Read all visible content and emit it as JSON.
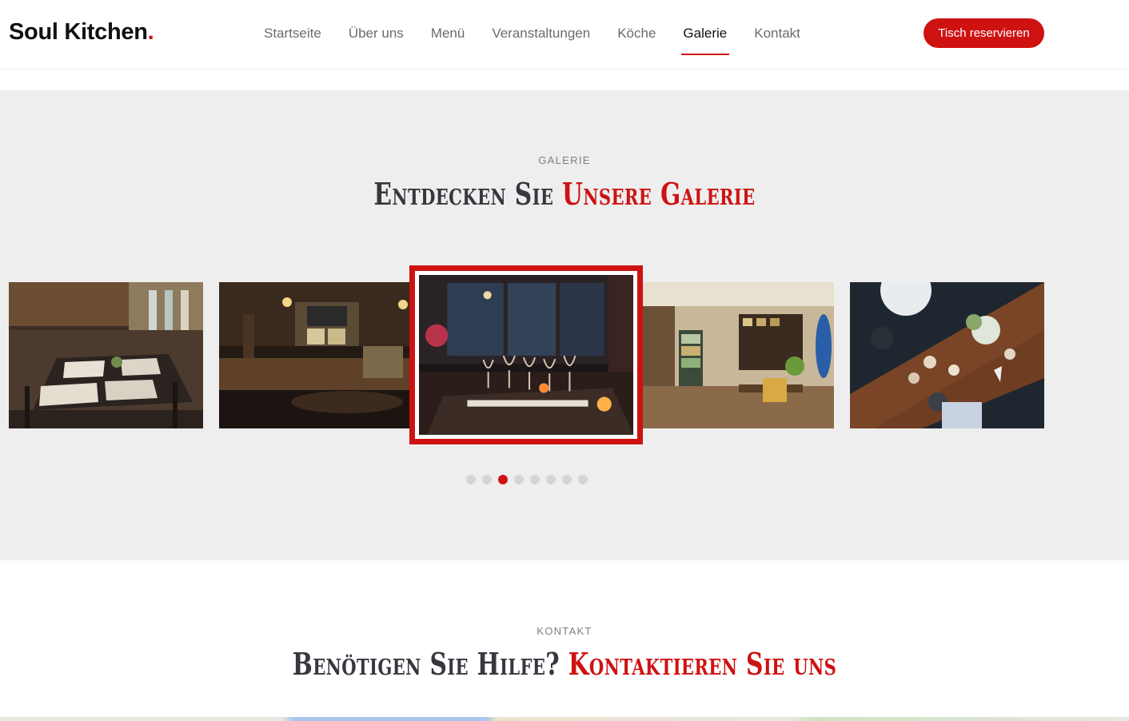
{
  "header": {
    "logo": {
      "text": "Soul Kitchen",
      "dot": "."
    },
    "nav": [
      {
        "label": "Startseite",
        "active": false
      },
      {
        "label": "Über uns",
        "active": false
      },
      {
        "label": "Menü",
        "active": false
      },
      {
        "label": "Veranstaltungen",
        "active": false
      },
      {
        "label": "Köche",
        "active": false
      },
      {
        "label": "Galerie",
        "active": true
      },
      {
        "label": "Kontakt",
        "active": false
      }
    ],
    "cta_label": "Tisch reservieren"
  },
  "gallery": {
    "subtitle": "GALERIE",
    "title_part1": "Entdecken Sie ",
    "title_part2": "Unsere Galerie",
    "slides": [
      {
        "icon": "restaurant-tables-photo"
      },
      {
        "icon": "restaurant-bar-photo"
      },
      {
        "icon": "wine-glasses-table-photo",
        "active": true
      },
      {
        "icon": "cafe-interior-photo"
      },
      {
        "icon": "dinner-table-overhead-photo"
      }
    ],
    "pagination": {
      "count": 8,
      "active_index": 2
    }
  },
  "contact": {
    "subtitle": "KONTAKT",
    "title_part1": "Benötigen Sie Hilfe? ",
    "title_part2": "Kontaktieren Sie uns"
  },
  "colors": {
    "accent": "#ce1212",
    "text_dark": "#37373f",
    "section_bg": "#eeeeee",
    "dot_inactive": "#d5d5d5"
  }
}
